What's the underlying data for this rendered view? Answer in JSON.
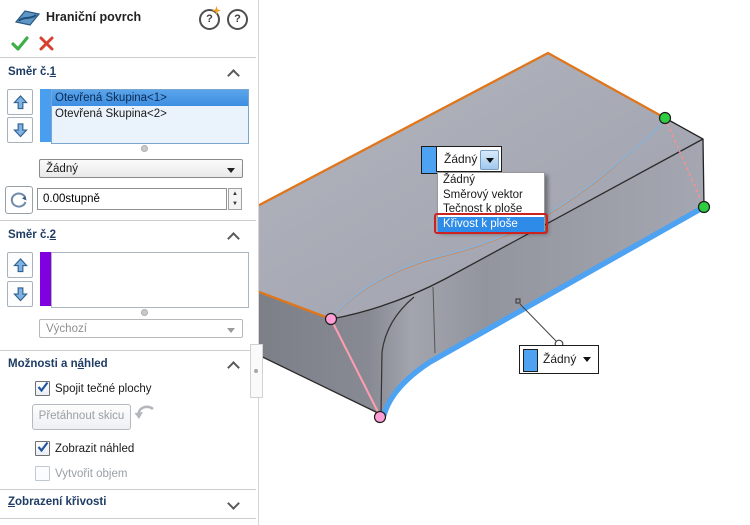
{
  "panel": {
    "title": "Hraniční povrch",
    "sections": {
      "dir1": {
        "label_pre": "Směr č.",
        "label_key": "1",
        "label_post": "",
        "items": [
          "Otevřená Skupina<1>",
          "Otevřená Skupina<2>"
        ],
        "strip_color": "#4a9ef0",
        "combo_value": "Žádný",
        "angle_value": "0.00stupně"
      },
      "dir2": {
        "label_pre": "Směr č.",
        "label_key": "2",
        "label_post": "",
        "strip_color": "#8000e0",
        "combo_value": "Výchozí"
      },
      "options": {
        "label_pre": "Možnosti a n",
        "label_key": "á",
        "label_post": "hled",
        "cb_tangent": "Spojit tečné plochy",
        "drag_button": "Přetáhnout skicu",
        "cb_preview": "Zobrazit náhled",
        "cb_solid": "Vytvořit objem"
      },
      "curvature": {
        "label_pre": "",
        "label_key": "Z",
        "label_post": "obrazení křivosti"
      }
    }
  },
  "viewport": {
    "callout_top": {
      "value": "Žádný",
      "options": [
        "Žádný",
        "Směrový vektor",
        "Tečnost k ploše",
        "Křivost k ploše"
      ],
      "highlight_color": "#2f8be8",
      "annotation_color": "#cc2222",
      "swatch_color": "#4da2f2"
    },
    "callout_bottom": {
      "value": "Žádný",
      "swatch_color": "#4da2f2"
    },
    "colors": {
      "selected_edge_orange": "#e0761c",
      "bottom_edge_blue": "#4da2f2",
      "vertex_green": "#2ecc40",
      "vertex_pink": "#ff9ed4",
      "connector_pink": "#ff9db0"
    }
  }
}
